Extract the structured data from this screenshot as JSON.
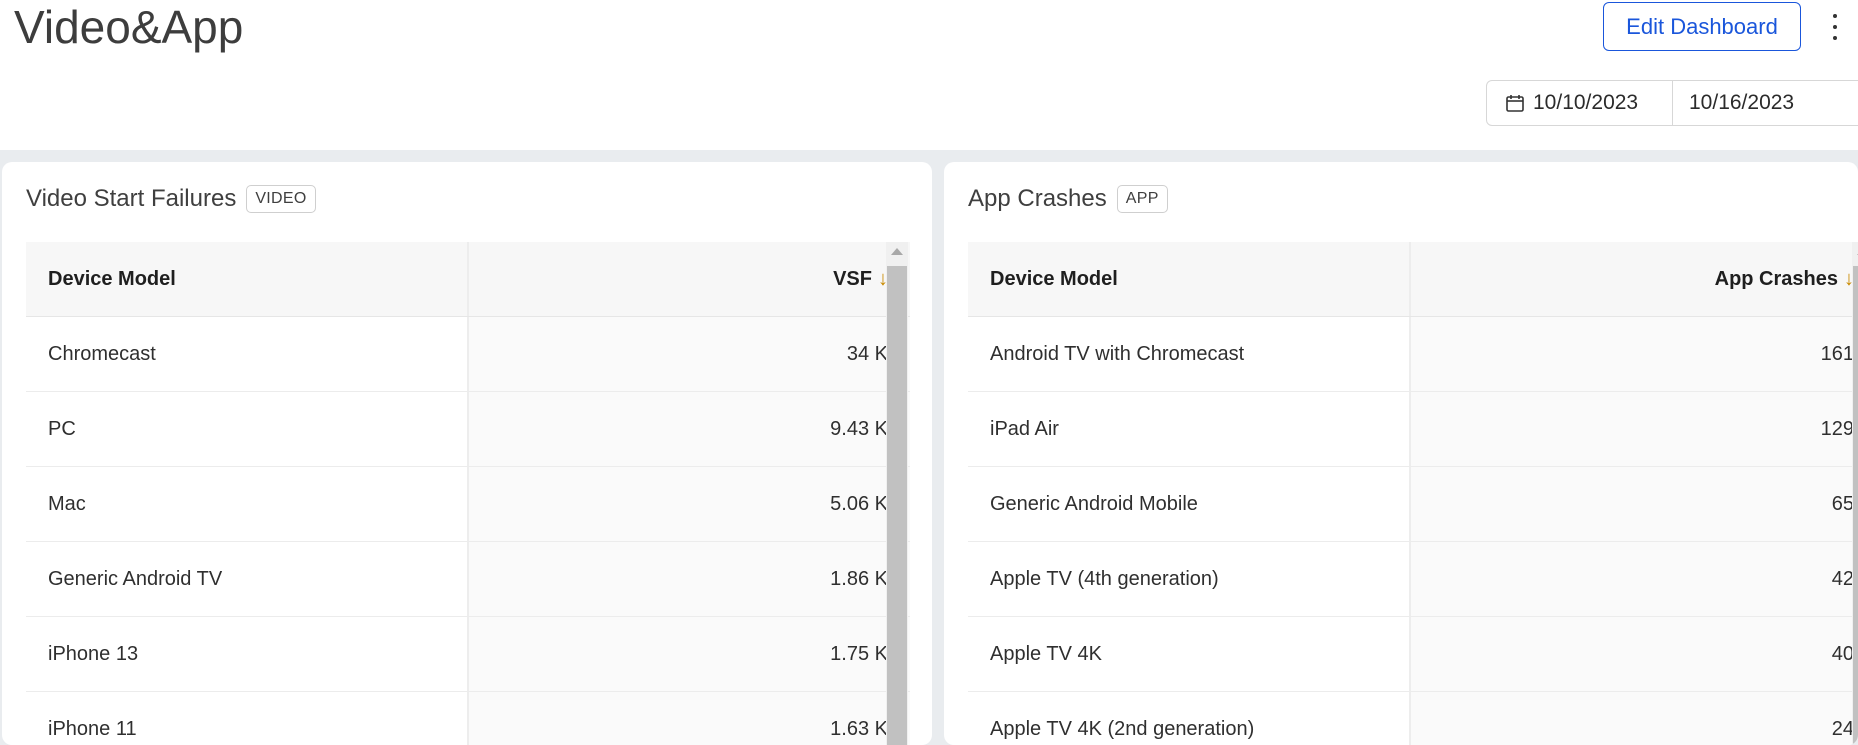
{
  "page": {
    "title": "Video&App"
  },
  "toolbar": {
    "edit_label": "Edit Dashboard",
    "more_icon": "more-vertical-icon"
  },
  "date_range": {
    "start": "10/10/2023",
    "end": "10/16/2023",
    "icon": "calendar-icon"
  },
  "colors": {
    "accent": "#1a56db",
    "sort_arrow": "#c98a00",
    "canvas": "#e9ecef"
  },
  "video_panel": {
    "title": "Video Start Failures",
    "tag": "VIDEO",
    "columns": [
      "Device Model",
      "VSF"
    ],
    "sort_arrow": "↓",
    "rows": [
      {
        "device": "Chromecast",
        "value": "34 K"
      },
      {
        "device": "PC",
        "value": "9.43 K"
      },
      {
        "device": "Mac",
        "value": "5.06 K"
      },
      {
        "device": "Generic Android TV",
        "value": "1.86 K"
      },
      {
        "device": "iPhone 13",
        "value": "1.75 K"
      },
      {
        "device": "iPhone 11",
        "value": "1.63 K"
      }
    ]
  },
  "app_panel": {
    "title": "App Crashes",
    "tag": "APP",
    "columns": [
      "Device Model",
      "App Crashes"
    ],
    "sort_arrow": "↓",
    "rows": [
      {
        "device": "Android TV with Chromecast",
        "value": "161"
      },
      {
        "device": "iPad Air",
        "value": "129"
      },
      {
        "device": "Generic Android Mobile",
        "value": "65"
      },
      {
        "device": "Apple TV (4th generation)",
        "value": "42"
      },
      {
        "device": "Apple TV 4K",
        "value": "40"
      },
      {
        "device": "Apple TV 4K (2nd generation)",
        "value": "24"
      }
    ]
  }
}
